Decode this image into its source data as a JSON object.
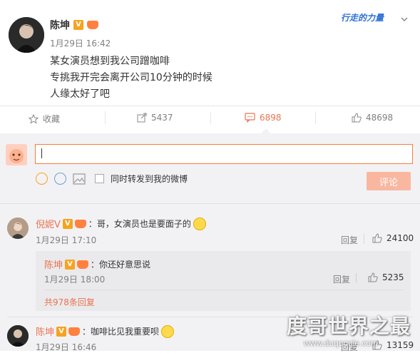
{
  "post": {
    "author": "陈坤",
    "vip_badge": "V",
    "time": "1月29日 16:42",
    "lines": [
      "某女演员想到我公司蹭咖啡",
      "专挑我开完会离开公司10分钟的时候",
      "人缘太好了吧"
    ],
    "banner_text": "行走的力量"
  },
  "actions": {
    "favorite": "收藏",
    "repost_count": "5437",
    "comment_count": "6898",
    "like_count": "48698"
  },
  "composer": {
    "input_value": "",
    "also_repost_label": "同时转发到我的微博",
    "submit_label": "评论"
  },
  "comments": [
    {
      "author": "倪妮V",
      "text": "：哥，女演员也是要面子的",
      "time": "1月29日 17:10",
      "reply_label": "回复",
      "likes": "24100",
      "reply": {
        "author": "陈坤",
        "text": "：你还好意思说",
        "time": "1月29日 18:00",
        "reply_label": "回复",
        "likes": "5235"
      },
      "more_replies": "共978条回复"
    },
    {
      "author": "陈坤",
      "text": "：咖啡比见我重要呗",
      "time": "1月29日 16:46",
      "reply_label": "回复",
      "likes": "13159"
    }
  ],
  "watermark": {
    "brand": "度哥世界之最",
    "url": "www.duqoogle.com"
  },
  "colors": {
    "accent": "#eb7350",
    "submit_bg": "#f9b7a0",
    "input_border": "#fa7d3c"
  }
}
